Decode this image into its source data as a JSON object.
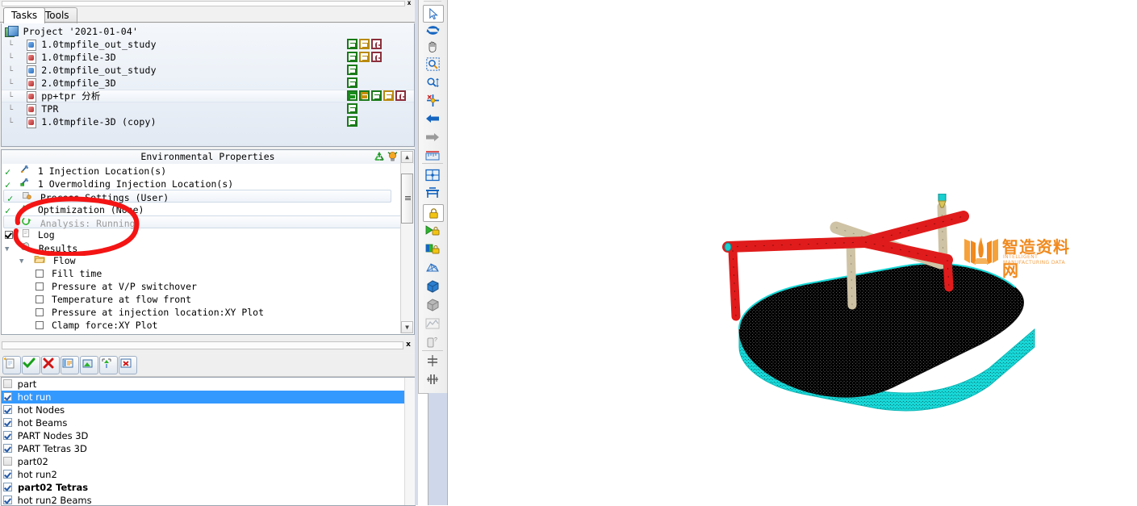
{
  "window": {
    "tabs": [
      {
        "label": "Tasks",
        "active": true
      },
      {
        "label": "Tools",
        "active": false
      }
    ],
    "close_label": "x",
    "panel_close_label": "x"
  },
  "project_tree": {
    "root": {
      "label": "Project '2021-01-04'",
      "icon": "project-icon"
    },
    "items": [
      {
        "label": "1.0tmpfile_out_study",
        "icon": "doc-blue-icon",
        "badges": [
          "green",
          "gold",
          "maroon"
        ],
        "selected": false
      },
      {
        "label": "1.0tmpfile-3D",
        "icon": "doc-red-icon",
        "badges": [
          "green",
          "gold",
          "maroon"
        ],
        "selected": false
      },
      {
        "label": "2.0tmpfile_out_study",
        "icon": "doc-blue-icon",
        "badges": [
          "green"
        ],
        "selected": false
      },
      {
        "label": "2.0tmpfile_3D",
        "icon": "doc-red-icon",
        "badges": [
          "green"
        ],
        "selected": false
      },
      {
        "label": "pp+tpr 分析",
        "icon": "doc-red-icon",
        "badges": [
          "fillgreen",
          "fillgold",
          "green",
          "gold",
          "maroon"
        ],
        "selected": true
      },
      {
        "label": "TPR",
        "icon": "doc-red-icon",
        "badges": [
          "green"
        ],
        "selected": false
      },
      {
        "label": "1.0tmpfile-3D (copy)",
        "icon": "doc-red-icon",
        "badges": [
          "green"
        ],
        "selected": false
      }
    ]
  },
  "study_tree": {
    "header": "Environmental Properties",
    "header_icons": [
      "recycle-icon",
      "lightbulb-icon"
    ],
    "items": [
      {
        "label": "1 Injection Location(s)",
        "marker": "check",
        "icon": "injection-icon",
        "indent": 0
      },
      {
        "label": "1 Overmolding Injection Location(s)",
        "marker": "check",
        "icon": "overmolding-icon",
        "indent": 0
      },
      {
        "label": "Process Settings (User)",
        "marker": "check",
        "icon": "process-icon",
        "indent": 0,
        "selected": true
      },
      {
        "label": "Optimization (None)",
        "marker": "check",
        "icon": "optimization-icon",
        "indent": 0
      },
      {
        "label": "Analysis: Running",
        "marker": "none",
        "icon": "running-icon",
        "indent": 0,
        "selected": true,
        "dim": true
      },
      {
        "label": "Log",
        "marker": "checkbox",
        "icon": "log-icon",
        "indent": 0
      },
      {
        "label": "Results",
        "marker": "expander",
        "icon": "results-icon",
        "indent": 0
      },
      {
        "label": "Flow",
        "marker": "expander",
        "icon": "folder-icon",
        "indent": 1
      },
      {
        "label": "Fill time",
        "marker": "checkbox",
        "icon": "",
        "indent": 2
      },
      {
        "label": "Pressure at V/P switchover",
        "marker": "checkbox",
        "icon": "",
        "indent": 2
      },
      {
        "label": "Temperature at flow front",
        "marker": "checkbox",
        "icon": "",
        "indent": 2
      },
      {
        "label": "Pressure at injection location:XY Plot",
        "marker": "checkbox",
        "icon": "",
        "indent": 2
      },
      {
        "label": "Clamp force:XY Plot",
        "marker": "checkbox",
        "icon": "",
        "indent": 2
      }
    ],
    "annotation": "red-hand-drawn-circle"
  },
  "layer_toolbar": {
    "buttons": [
      {
        "name": "new-layer-button",
        "icon": "new-layer-icon"
      },
      {
        "name": "activate-layer-button",
        "icon": "green-check-icon"
      },
      {
        "name": "deactivate-layer-button",
        "icon": "red-cross-icon"
      },
      {
        "name": "layer-properties-button",
        "icon": "list-icon"
      },
      {
        "name": "show-all-layers-button",
        "icon": "image-icon"
      },
      {
        "name": "expand-collapse-button",
        "icon": "expand-arrows-icon"
      },
      {
        "name": "delete-layer-button",
        "icon": "delete-icon"
      }
    ]
  },
  "layers": {
    "items": [
      {
        "label": "part",
        "checked": false,
        "selected": false,
        "bold": false
      },
      {
        "label": "hot  run",
        "checked": true,
        "selected": true,
        "bold": false
      },
      {
        "label": "hot  Nodes",
        "checked": true,
        "selected": false,
        "bold": false
      },
      {
        "label": "hot   Beams",
        "checked": true,
        "selected": false,
        "bold": false
      },
      {
        "label": "PART Nodes 3D",
        "checked": true,
        "selected": false,
        "bold": false
      },
      {
        "label": "PART Tetras 3D",
        "checked": true,
        "selected": false,
        "bold": false
      },
      {
        "label": "part02",
        "checked": false,
        "selected": false,
        "bold": false
      },
      {
        "label": "hot run2",
        "checked": true,
        "selected": false,
        "bold": false
      },
      {
        "label": "part02 Tetras",
        "checked": true,
        "selected": false,
        "bold": true
      },
      {
        "label": "hot run2  Beams",
        "checked": true,
        "selected": false,
        "bold": false
      }
    ]
  },
  "view_toolbar": {
    "buttons": [
      {
        "name": "select-tool",
        "icon": "cursor-arrow-icon",
        "selected": true
      },
      {
        "name": "rotate-tool",
        "icon": "rotate-icon",
        "selected": false
      },
      {
        "name": "pan-tool",
        "icon": "hand-icon",
        "selected": false
      },
      {
        "name": "zoom-window-tool",
        "icon": "zoom-window-icon",
        "selected": false
      },
      {
        "name": "zoom-tool",
        "icon": "magnifier-icon",
        "selected": false
      },
      {
        "name": "center-tool",
        "icon": "center-crosshair-icon",
        "selected": false
      },
      {
        "name": "previous-view",
        "icon": "blue-left-arrow-icon",
        "selected": false
      },
      {
        "name": "next-view",
        "icon": "grey-right-arrow-icon",
        "selected": false
      },
      {
        "name": "measure-tool",
        "icon": "ruler-icon",
        "selected": false
      },
      {
        "name": "fit-view",
        "icon": "fit-window-icon",
        "selected": false
      },
      {
        "name": "front-view",
        "icon": "bench-icon",
        "selected": false
      },
      {
        "name": "lock-view",
        "icon": "padlock-icon",
        "selected": false
      },
      {
        "name": "play-lock",
        "icon": "play-lock-icon",
        "selected": false
      },
      {
        "name": "color-lock",
        "icon": "color-lock-icon",
        "selected": false
      },
      {
        "name": "mesh-display",
        "icon": "mesh-icon",
        "selected": false
      },
      {
        "name": "solid-display",
        "icon": "blue-cube-icon",
        "selected": false
      },
      {
        "name": "shaded-display",
        "icon": "grey-cube-icon",
        "selected": false
      },
      {
        "name": "xy-plot",
        "icon": "xy-plot-icon",
        "selected": false
      },
      {
        "name": "query-tool",
        "icon": "query-icon",
        "selected": false
      },
      {
        "name": "section-horizontal",
        "icon": "section-h-icon",
        "selected": false
      },
      {
        "name": "section-vertical",
        "icon": "section-v-icon",
        "selected": false
      }
    ]
  },
  "canvas": {
    "watermark_title": "智造资料网",
    "watermark_subtitle": "INTELLIGENT MANUFACTURING DATA",
    "model_name": "mold-mesh-3d-model",
    "colors": {
      "part_fill": "#18d7d7",
      "mesh_dark": "#1a1a1a",
      "runner_red": "#e01b1b",
      "runner_tan": "#cfc3a5",
      "injector_cyan": "#19cfcf"
    }
  }
}
